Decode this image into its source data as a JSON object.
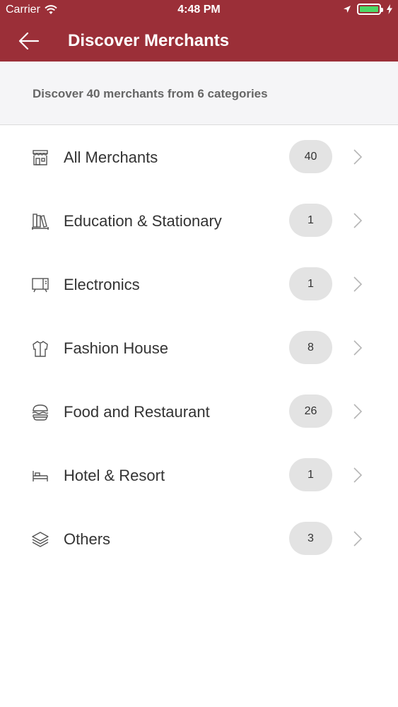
{
  "status": {
    "carrier": "Carrier",
    "time": "4:48 PM"
  },
  "header": {
    "title": "Discover Merchants"
  },
  "banner": {
    "text": "Discover 40 merchants from 6 categories"
  },
  "categories": [
    {
      "label": "All Merchants",
      "count": "40",
      "icon": "store-icon"
    },
    {
      "label": "Education & Stationary",
      "count": "1",
      "icon": "books-icon"
    },
    {
      "label": "Electronics",
      "count": "1",
      "icon": "tv-icon"
    },
    {
      "label": "Fashion House",
      "count": "8",
      "icon": "shirt-icon"
    },
    {
      "label": "Food and Restaurant",
      "count": "26",
      "icon": "burger-icon"
    },
    {
      "label": "Hotel & Resort",
      "count": "1",
      "icon": "bed-icon"
    },
    {
      "label": "Others",
      "count": "3",
      "icon": "layers-icon"
    }
  ],
  "colors": {
    "header": "#9b2f38",
    "banner": "#f5f5f7",
    "badge": "#e3e3e3",
    "battery": "#4cd964"
  }
}
